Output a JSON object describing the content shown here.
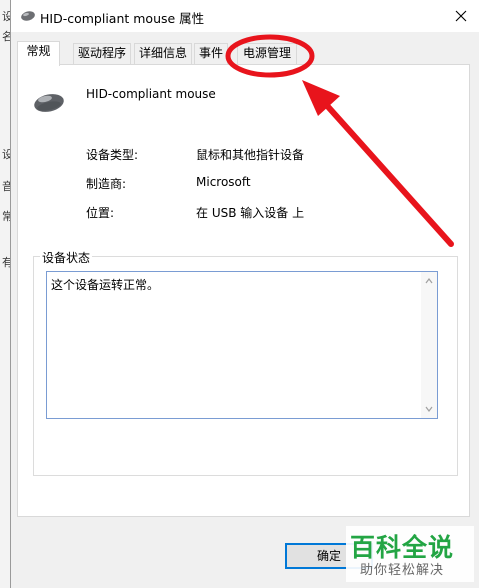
{
  "window": {
    "title": "HID-compliant mouse 属性",
    "close_icon": "close-icon"
  },
  "background_window": {
    "glyphs": [
      "设",
      "名",
      "设",
      "音",
      "常",
      "有"
    ]
  },
  "tabs": [
    {
      "label": "常规",
      "active": true
    },
    {
      "label": "驱动程序",
      "active": false
    },
    {
      "label": "详细信息",
      "active": false
    },
    {
      "label": "事件",
      "active": false
    },
    {
      "label": "电源管理",
      "active": false
    }
  ],
  "device": {
    "icon": "mouse-icon",
    "name": "HID-compliant mouse"
  },
  "properties": [
    {
      "label": "设备类型:",
      "value": "鼠标和其他指针设备"
    },
    {
      "label": "制造商:",
      "value": "Microsoft"
    },
    {
      "label": "位置:",
      "value": "在 USB 输入设备 上"
    }
  ],
  "status": {
    "legend": "设备状态",
    "text": "这个设备运转正常。"
  },
  "buttons": {
    "ok": "确定"
  },
  "annotation": {
    "color": "#e8141c"
  },
  "watermark": {
    "main": "百科全说",
    "sub": "助你轻松解决"
  }
}
